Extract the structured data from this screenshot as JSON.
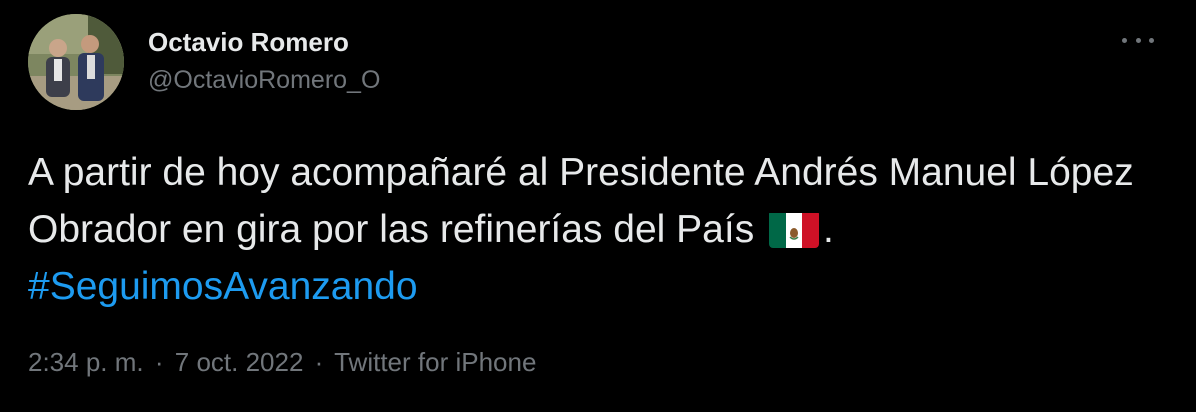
{
  "author": {
    "display_name": "Octavio Romero",
    "handle": "@OctavioRomero_O"
  },
  "tweet": {
    "text_part1": "A partir de hoy acompañaré al Presidente Andrés Manuel López Obrador en gira por las refinerías del País ",
    "text_part2": ". ",
    "hashtag": "#SeguimosAvanzando",
    "flag_emoji": "mexico-flag-emoji"
  },
  "meta": {
    "time": "2:34 p. m.",
    "date": "7 oct. 2022",
    "source": "Twitter for iPhone",
    "separator": "·"
  },
  "colors": {
    "background": "#000000",
    "text": "#e7e9ea",
    "secondary": "#71767b",
    "link": "#1d9bf0"
  },
  "icons": {
    "more": "more-horizontal-icon"
  }
}
